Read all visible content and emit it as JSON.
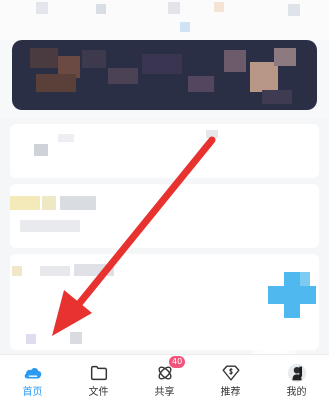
{
  "tabbar": {
    "tabs": [
      {
        "label": "首页",
        "icon": "cloud-home-icon",
        "active": true,
        "badge": ""
      },
      {
        "label": "文件",
        "icon": "folder-icon",
        "active": false,
        "badge": ""
      },
      {
        "label": "共享",
        "icon": "share-orbit-icon",
        "active": false,
        "badge": "40"
      },
      {
        "label": "推荐",
        "icon": "recommend-diamond-icon",
        "active": false,
        "badge": ""
      },
      {
        "label": "我的",
        "icon": "avatar-icon",
        "active": false,
        "badge": ""
      }
    ]
  },
  "colors": {
    "accent": "#2b9af3",
    "badge": "#f2537a",
    "annotation_arrow": "#e8322f",
    "banner": "#2a2f45"
  }
}
